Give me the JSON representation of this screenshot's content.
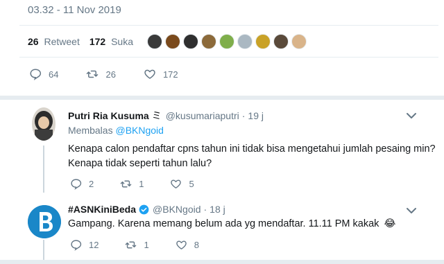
{
  "tweet": {
    "timestamp": "03.32 - 11 Nov 2019",
    "retweets": {
      "count": "26",
      "label": "Retweet"
    },
    "likes": {
      "count": "172",
      "label": "Suka"
    },
    "actions": {
      "reply": "64",
      "retweet": "26",
      "like": "172"
    },
    "liker_avatars": [
      "#3a3a3a",
      "#7a4a1c",
      "#2f2f2f",
      "#8c6a3a",
      "#7fae4b",
      "#aab8c2",
      "#c9a227",
      "#5a4a3a",
      "#d9b48a"
    ]
  },
  "reply1": {
    "name": "Putri Ria Kusuma",
    "name_suffix": "ミ",
    "handle": "@kusumariaputri",
    "time": "19 j",
    "replying_label": "Membalas",
    "replying_handle": "@BKNgoid",
    "text_line1": "Kenapa calon pendaftar cpns tahun ini tidak bisa mengetahui jumlah pesaing min?",
    "text_line2": "Kenapa tidak seperti tahun lalu?",
    "actions": {
      "reply": "2",
      "retweet": "1",
      "like": "5"
    }
  },
  "reply2": {
    "name": "#ASNKiniBeda",
    "handle": "@BKNgoid",
    "time": "18 j",
    "text": "Gampang. Karena memang belum ada yg mendaftar. 11.11 PM kakak",
    "emoji": "😂",
    "actions": {
      "reply": "12",
      "retweet": "1",
      "like": "8"
    }
  },
  "colors": {
    "link": "#1da1f2",
    "muted": "#657786",
    "verified": "#1da1f2",
    "bkn_blue": "#1a87c8"
  }
}
